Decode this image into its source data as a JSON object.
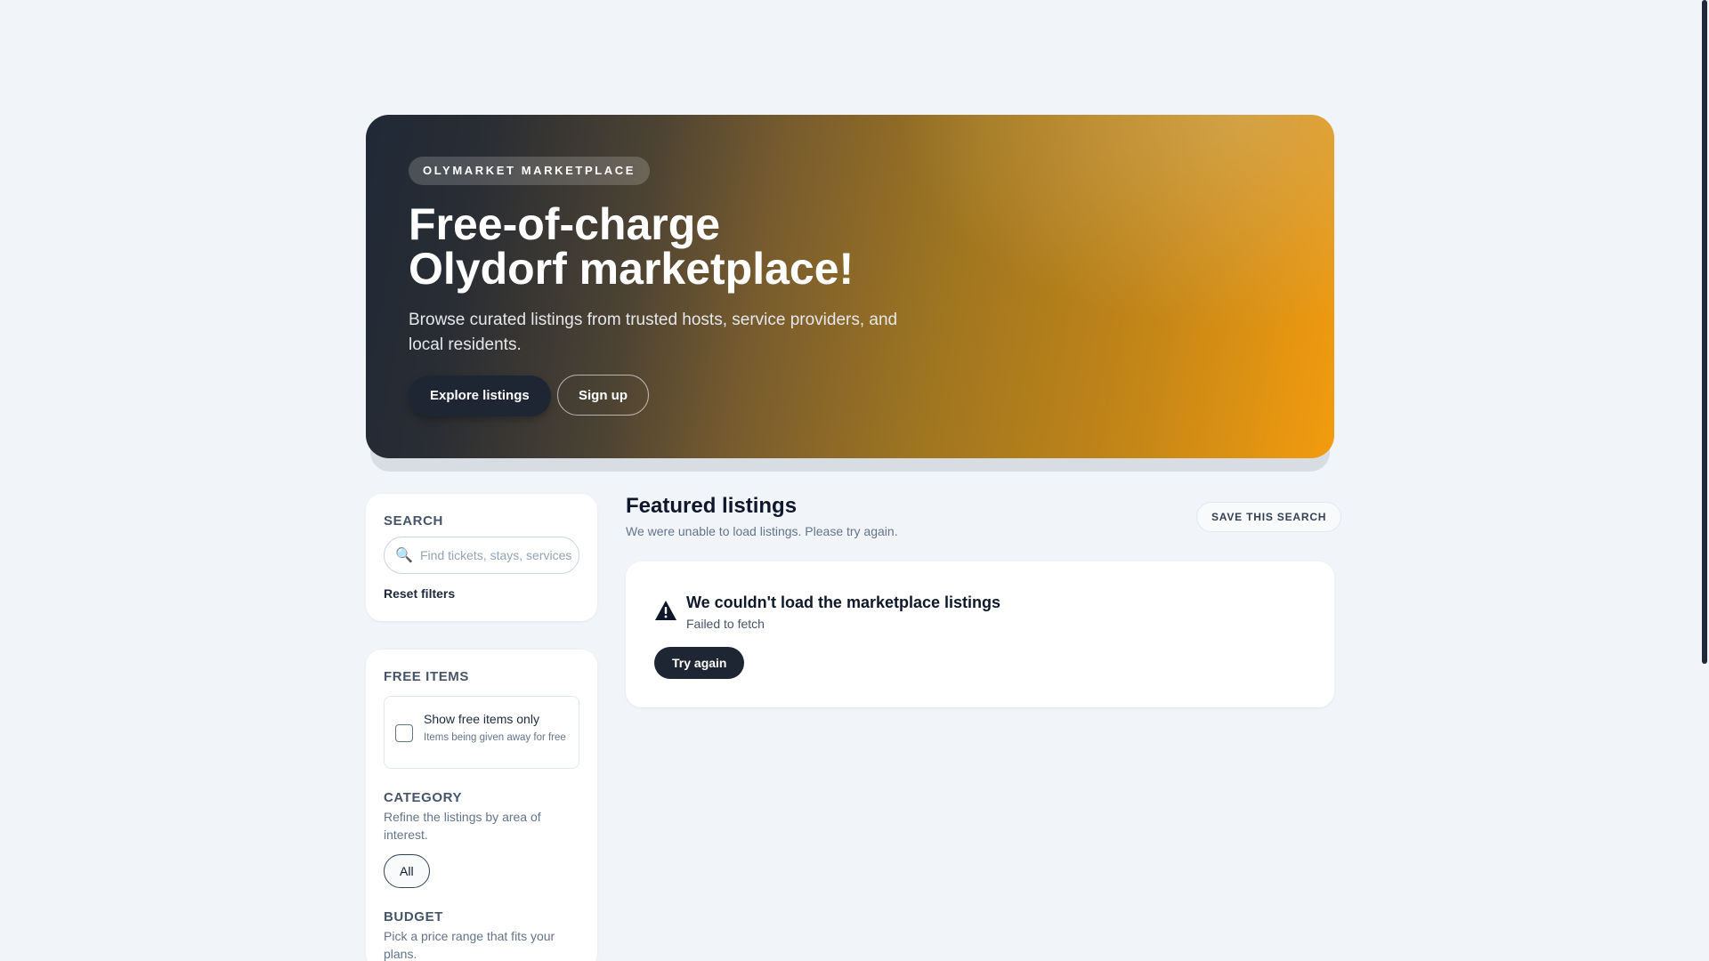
{
  "hero": {
    "badge": "OLYMARKET MARKETPLACE",
    "title_line1": "Free-of-charge",
    "title_line2": "Olydorf marketplace!",
    "subtitle": "Browse curated listings from trusted hosts, service providers, and local residents.",
    "explore_label": "Explore listings",
    "signup_label": "Sign up"
  },
  "sidebar": {
    "search": {
      "label": "SEARCH",
      "placeholder": "Find tickets, stays, services...",
      "icon": "search-icon",
      "reset_label": "Reset filters"
    },
    "free_items": {
      "label": "FREE ITEMS",
      "checkbox_label": "Show free items only",
      "checkbox_desc": "Items being given away for free",
      "checked": false
    },
    "category": {
      "label": "CATEGORY",
      "description": "Refine the listings by area of interest.",
      "selected_option": "All"
    },
    "budget": {
      "label": "BUDGET",
      "description": "Pick a price range that fits your plans."
    }
  },
  "main": {
    "title": "Featured listings",
    "subtitle": "We were unable to load listings. Please try again.",
    "save_search_label": "SAVE THIS SEARCH",
    "error": {
      "icon": "warning-icon",
      "title": "We couldn't load the marketplace listings",
      "message": "Failed to fetch",
      "retry_label": "Try again"
    }
  },
  "colors": {
    "page_bg": "#f1f5f9",
    "hero_start": "#1f2937",
    "hero_end": "#f39c0e",
    "primary_button": "#1e2633"
  }
}
